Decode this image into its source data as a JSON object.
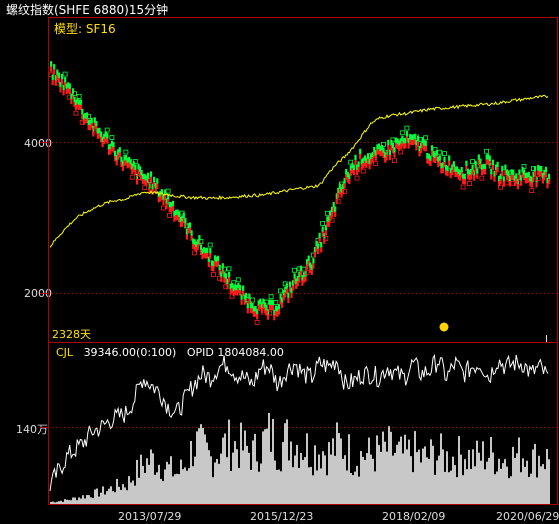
{
  "header": {
    "title": "螺纹指数(SHFE 6880)15分钟",
    "model_label": "模型: SF16",
    "days_label": "2328天"
  },
  "indicator": {
    "name": "CJL",
    "volume_text": "39346.00(0:100)",
    "opid_text": "OPID 1804084.00"
  },
  "y_axis_labels": [
    "4000",
    "2000",
    "140万"
  ],
  "x_axis_labels": [
    "2013/07/29",
    "2015/12/23",
    "2018/02/09",
    "2020/06/29"
  ],
  "colors": {
    "up": "#00ff3a",
    "down": "#ff1a1a",
    "ma_line": "#ffff00",
    "opid_line": "#ffffff",
    "volume": "#c8c8c8",
    "frame": "#b00000",
    "marker": "#ffd400"
  },
  "chart_data": [
    {
      "type": "line",
      "title": "",
      "y_ticks": [
        4000,
        2000
      ],
      "x_tick_labels": [
        "2013/07/29",
        "2015/12/23",
        "2018/02/09",
        "2020/06/29"
      ],
      "series": [
        {
          "values": [
            4920,
            4820,
            4700,
            4560,
            4350,
            4200,
            4080,
            3960,
            3820,
            3700,
            3600,
            3520,
            3450,
            3320,
            3200,
            3050,
            2880,
            2700,
            2560,
            2460,
            2320,
            2160,
            2030,
            1920,
            1840,
            1780,
            1760,
            1850,
            2000,
            2150,
            2280,
            2420,
            2700,
            2950,
            3250,
            3520,
            3700,
            3800,
            3760,
            3850,
            3900,
            3950,
            4000,
            3980,
            3950,
            3820,
            3720,
            3700,
            3650,
            3600,
            3620,
            3720,
            3680,
            3580,
            3560,
            3520,
            3550,
            3560,
            3540,
            3540
          ]
        },
        {
          "values": [
            2620,
            2760,
            2880,
            2990,
            3060,
            3120,
            3170,
            3210,
            3240,
            3250,
            3300,
            3340,
            3340,
            3320,
            3310,
            3290,
            3280,
            3270,
            3270,
            3260,
            3270,
            3270,
            3280,
            3290,
            3300,
            3300,
            3320,
            3340,
            3360,
            3380,
            3400,
            3410,
            3440,
            3600,
            3720,
            3820,
            3950,
            4100,
            4250,
            4320,
            4350,
            4370,
            4380,
            4400,
            4420,
            4440,
            4450,
            4460,
            4470,
            4480,
            4490,
            4500,
            4510,
            4520,
            4540,
            4560,
            4570,
            4590,
            4600,
            4610
          ]
        }
      ]
    },
    {
      "type": "area",
      "title": "",
      "series": [
        {
          "name": "OPID",
          "values": [
            20,
            40,
            60,
            70,
            80,
            95,
            100,
            110,
            115,
            120,
            140,
            170,
            160,
            150,
            130,
            120,
            140,
            160,
            175,
            170,
            185,
            190,
            175,
            170,
            160,
            185,
            185,
            160,
            180,
            190,
            175,
            170,
            190,
            185,
            195,
            160,
            165,
            175,
            175,
            170,
            185,
            175,
            170,
            190,
            175,
            180,
            195,
            170,
            190,
            175,
            185,
            190,
            170,
            195,
            185,
            190,
            190,
            175,
            185,
            170
          ]
        },
        {
          "name": "CJL",
          "values": [
            2,
            3,
            4,
            6,
            8,
            10,
            12,
            15,
            18,
            20,
            30,
            40,
            45,
            40,
            35,
            30,
            40,
            60,
            55,
            45,
            55,
            60,
            58,
            55,
            50,
            60,
            70,
            55,
            65,
            60,
            58,
            52,
            55,
            50,
            60,
            55,
            45,
            50,
            48,
            52,
            55,
            50,
            48,
            52,
            45,
            48,
            50,
            45,
            47,
            50,
            45,
            48,
            50,
            46,
            44,
            48,
            50,
            45,
            47,
            45
          ]
        }
      ]
    }
  ]
}
